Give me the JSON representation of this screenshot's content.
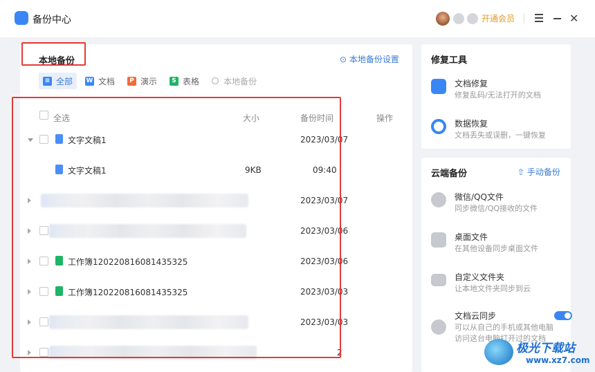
{
  "app": {
    "title": "备份中心",
    "vip_label": "开通会员"
  },
  "local": {
    "section_title": "本地备份",
    "settings_label": "本地备份设置",
    "tabs": [
      {
        "label": "全部",
        "icon": "list-icon",
        "color": "#3a86f5"
      },
      {
        "label": "文档",
        "icon": "doc-w-icon",
        "color": "#3a86f5"
      },
      {
        "label": "演示",
        "icon": "ppt-p-icon",
        "color": "#ef6c3a"
      },
      {
        "label": "表格",
        "icon": "sheet-s-icon",
        "color": "#1fb466"
      },
      {
        "label": "本地备份",
        "icon": "search-icon"
      }
    ],
    "headers": {
      "select_all": "全选",
      "size": "大小",
      "time": "备份时间",
      "action": "操作"
    },
    "rows": [
      {
        "name": "文字文稿1",
        "date": "2023/03/07",
        "expanded": true
      },
      {
        "name": "文字文稿1",
        "size": "9KB",
        "time": "09:40"
      },
      {
        "name": "",
        "date": "2023/03/07"
      },
      {
        "name": "",
        "date": "2023/03/06"
      },
      {
        "name": "工作簿120220816081435325",
        "date": "2023/03/06"
      },
      {
        "name": "工作簿120220816081435325",
        "date": "2023/03/03"
      },
      {
        "name": "",
        "date": "2023/03/03"
      },
      {
        "name": "",
        "date": "2"
      }
    ]
  },
  "repair": {
    "title": "修复工具",
    "tools": [
      {
        "name": "文档修复",
        "desc": "修复乱码/无法打开的文档",
        "icon": "doc-repair-icon",
        "color": "#3a86f5"
      },
      {
        "name": "数据恢复",
        "desc": "文档丢失或误删，一键恢复",
        "icon": "data-recover-icon",
        "color": "#3a86f5"
      }
    ]
  },
  "cloud": {
    "title": "云端备份",
    "manual_label": "手动备份",
    "items": [
      {
        "name": "微信/QQ文件",
        "desc": "同步微信/QQ接收的文件",
        "icon": "chat-icon"
      },
      {
        "name": "桌面文件",
        "desc": "在其他设备同步桌面文件",
        "icon": "desktop-icon"
      },
      {
        "name": "自定义文件夹",
        "desc": "让本地文件夹同步到云",
        "icon": "folder-icon"
      },
      {
        "name": "文档云同步",
        "desc": "可以从自己的手机或其他电脑",
        "desc2": "访问这台电脑打开过的文档",
        "icon": "cloud-upload-icon",
        "toggle_on": true
      }
    ]
  },
  "watermark": {
    "title": "极光下载站",
    "url": "www.xz7.com"
  }
}
